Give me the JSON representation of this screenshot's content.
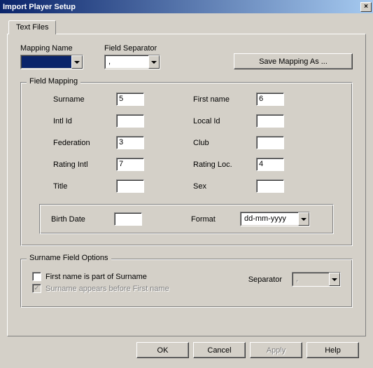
{
  "window": {
    "title": "Import Player Setup"
  },
  "tabs": {
    "textfiles": "Text Files"
  },
  "toprow": {
    "mapping_label": "Mapping Name",
    "mapping_value": "",
    "separator_label": "Field Separator",
    "separator_value": ",",
    "save_button": "Save Mapping As ..."
  },
  "field_mapping": {
    "group_title": "Field Mapping",
    "labels": {
      "surname": "Surname",
      "first_name": "First name",
      "intl_id": "Intl Id",
      "local_id": "Local Id",
      "federation": "Federation",
      "club": "Club",
      "rating_intl": "Rating Intl",
      "rating_loc": "Rating Loc.",
      "title": "Title",
      "sex": "Sex",
      "birth_date": "Birth Date",
      "format": "Format"
    },
    "values": {
      "surname": "5",
      "first_name": "6",
      "intl_id": "",
      "local_id": "",
      "federation": "3",
      "club": "",
      "rating_intl": "7",
      "rating_loc": "4",
      "title": "",
      "sex": "",
      "birth_date": "",
      "format": "dd-mm-yyyy"
    }
  },
  "surname_opts": {
    "group_title": "Surname Field Options",
    "part_of_surname": "First name is part of Surname",
    "part_of_surname_checked": false,
    "appears_before": "Surname appears before First name",
    "appears_before_checked": true,
    "separator_label": "Separator",
    "separator_value": ","
  },
  "buttons": {
    "ok": "OK",
    "cancel": "Cancel",
    "apply": "Apply",
    "help": "Help"
  }
}
